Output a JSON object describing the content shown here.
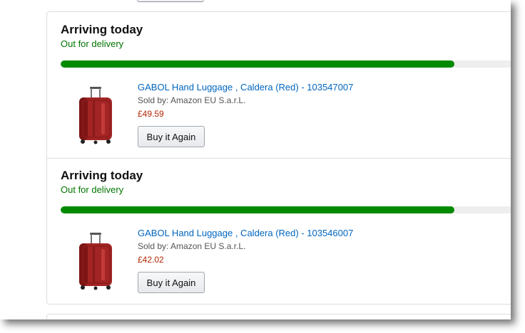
{
  "orders": [
    {
      "headline": "Arriving today",
      "status": "Out for delivery",
      "progress_fraction": 0.8,
      "item": {
        "title": "GABOL Hand Luggage , Caldera (Red) - 103547007",
        "sold_by": "Sold by: Amazon EU S.a.r.L.",
        "price": "£49.59",
        "buy_again_label": "Buy it Again",
        "image_icon": "red-suitcase-icon"
      }
    },
    {
      "headline": "Arriving today",
      "status": "Out for delivery",
      "progress_fraction": 0.8,
      "item": {
        "title": "GABOL Hand Luggage , Caldera (Red) - 103546007",
        "sold_by": "Sold by: Amazon EU S.a.r.L.",
        "price": "£42.02",
        "buy_again_label": "Buy it Again",
        "image_icon": "red-suitcase-icon"
      }
    }
  ],
  "colors": {
    "status_green": "#007600",
    "progress_fill": "#008a00",
    "progress_track": "#eeeeee",
    "link_blue": "#0066c0",
    "price_red": "#b12704",
    "suitcase_red": "#a52a2a"
  }
}
